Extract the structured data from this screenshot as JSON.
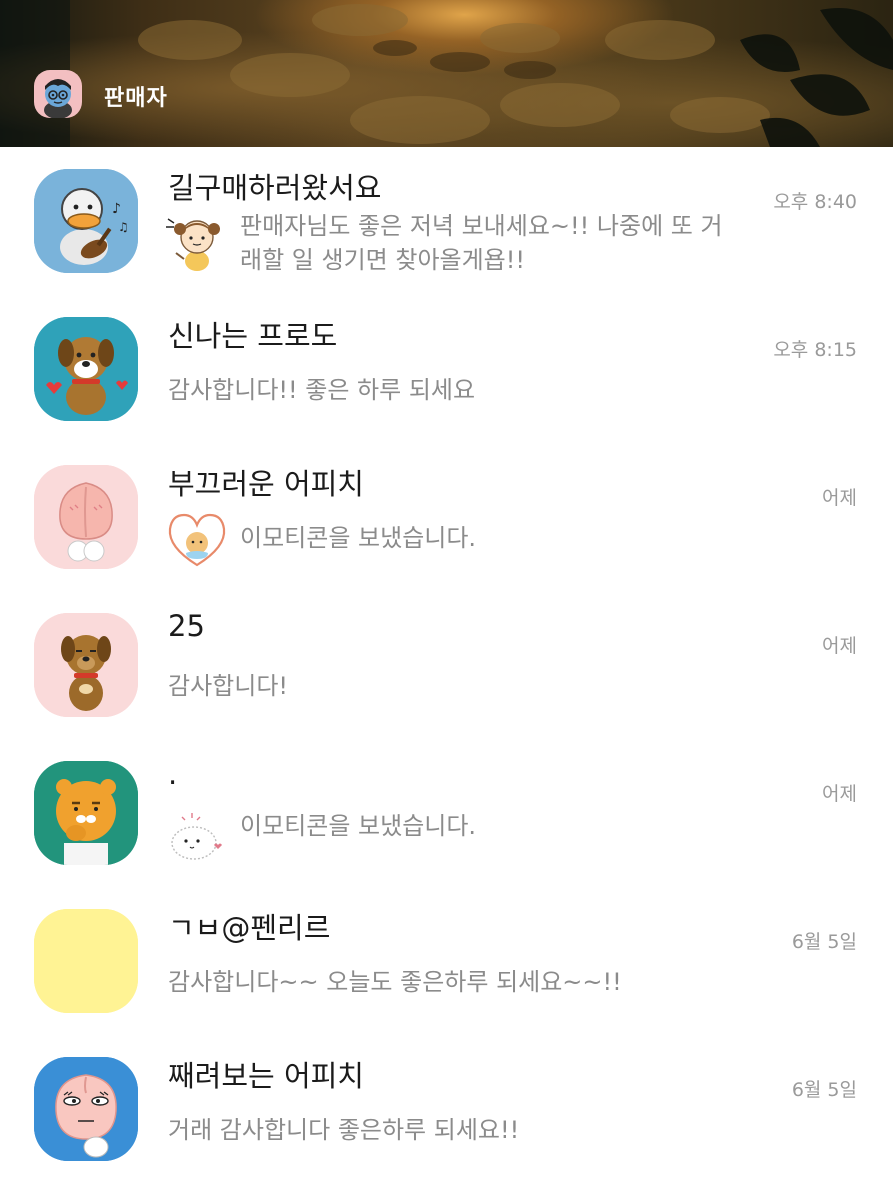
{
  "header": {
    "profile_name": "판매자",
    "profile_avatar_icon": "boy-character-avatar-icon"
  },
  "chats": [
    {
      "name": "길구매하러왔서요",
      "time": "오후 8:40",
      "message": "판매자님도 좋은 저녁 보내세요~!! 나중에 또 거래할 일 생기면 찾아올게욥!!",
      "avatar_bg": "#7ab3da",
      "avatar_icon": "duck-guitar-avatar-icon",
      "message_icon": "girl-sticker-icon"
    },
    {
      "name": "신나는 프로도",
      "time": "오후 8:15",
      "message": "감사합니다!! 좋은 하루 되세요",
      "avatar_bg": "#2fa2b9",
      "avatar_icon": "frodo-dog-avatar-icon"
    },
    {
      "name": "부끄러운 어피치",
      "time": "어제",
      "message": "이모티콘을 보냈습니다.",
      "avatar_bg": "#fadada",
      "avatar_icon": "apeach-avatar-icon",
      "message_icon": "heart-emoticon-icon"
    },
    {
      "name": "25",
      "time": "어제",
      "message": "감사합니다!",
      "avatar_bg": "#fadada",
      "avatar_icon": "dog-character-avatar-icon"
    },
    {
      "name": ".",
      "time": "어제",
      "message": "이모티콘을 보냈습니다.",
      "avatar_bg": "#22947c",
      "avatar_icon": "ryan-avatar-icon",
      "message_icon": "white-bear-emoticon-icon"
    },
    {
      "name": "ㄱㅂ@펜리르",
      "time": "6월 5일",
      "message": "감사합니다~~ 오늘도 좋은하루 되세요~~!!",
      "avatar_bg": "#fff394",
      "avatar_icon": "blank-yellow-avatar-icon"
    },
    {
      "name": "째려보는 어피치",
      "time": "6월 5일",
      "message": "거래 감사합니다 좋은하루 되세요!!",
      "avatar_bg": "#3a8fd6",
      "avatar_icon": "apeach-glare-avatar-icon"
    }
  ]
}
